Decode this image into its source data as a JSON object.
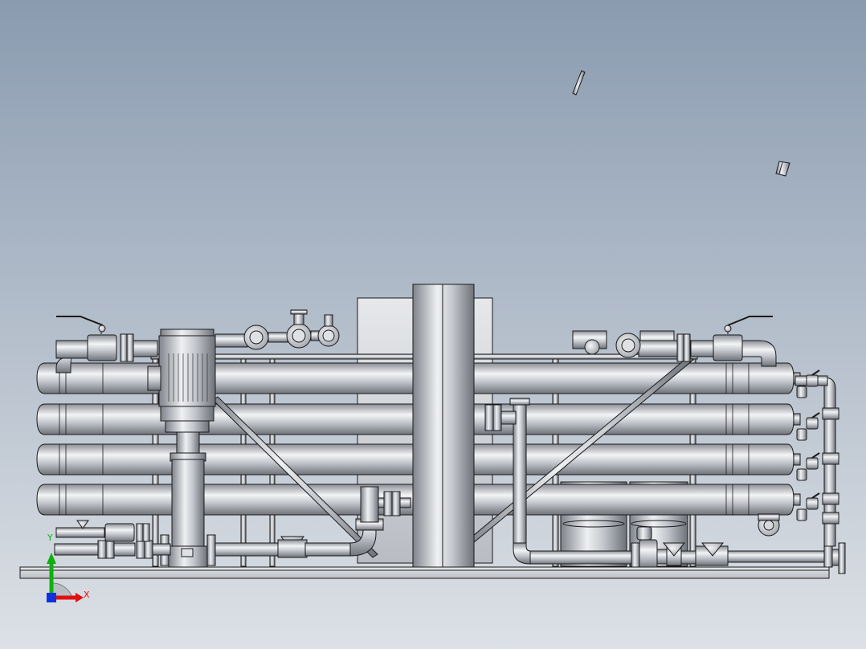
{
  "viewport": {
    "background_top": "#8a9bb0",
    "background_bottom": "#dde1e6"
  },
  "colors": {
    "metal_dark": "#7d8188",
    "metal_mid": "#c9ccd2",
    "metal_light": "#f2f3f5",
    "outline": "#1a1a1a",
    "axis_x": "#e01010",
    "axis_y": "#10b010",
    "axis_z": "#1030e0"
  },
  "triad": {
    "x_label": "X",
    "y_label": "Y"
  },
  "icons": [
    "coordinate-triad-icon"
  ]
}
